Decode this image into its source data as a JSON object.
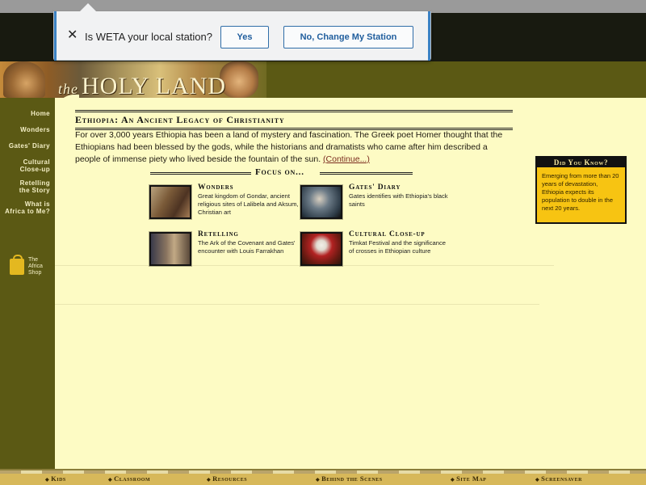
{
  "popup": {
    "question": "Is WETA your local station?",
    "yes_label": "Yes",
    "no_label": "No, Change My Station",
    "close_icon": "close-icon"
  },
  "banner": {
    "title_small": "the",
    "title_large": "HOLY LAND"
  },
  "left_nav": {
    "items": [
      {
        "lines": [
          "Home"
        ]
      },
      {
        "lines": [
          "Wonders"
        ]
      },
      {
        "lines": [
          "Gates' Diary"
        ]
      },
      {
        "lines": [
          "Cultural",
          "Close-up"
        ]
      },
      {
        "lines": [
          "Retelling",
          "the Story"
        ]
      },
      {
        "lines": [
          "What is",
          "Africa to Me?"
        ]
      }
    ],
    "shop": {
      "line1": "The",
      "line2": "Africa",
      "line3": "Shop",
      "icon": "shopping-bag-icon"
    }
  },
  "main": {
    "title": "Ethiopia: An Ancient Legacy of Christianity",
    "intro": "For over 3,000 years Ethiopia has been a land of mystery and fascination. The Greek poet Homer thought that the Ethiopians had been blessed by the gods, while the historians and dramatists who came after him described a people of immense piety who lived beside the fountain of the sun.",
    "continue_link": "(Continue...)",
    "focus_heading": "Focus on...",
    "focus_items": [
      {
        "title": "Wonders",
        "desc": "Great kingdom of Gondar, ancient religious sites of Lalibela and Aksum, Christian art"
      },
      {
        "title": "Gates' Diary",
        "desc": "Gates identifies with Ethiopia's black saints"
      },
      {
        "title": "Retelling",
        "desc": "The Ark of the Covenant and Gates' encounter with Louis Farrakhan"
      },
      {
        "title": "Cultural Close-up",
        "desc": "Timkat Festival and the significance of crosses in Ethiopian culture"
      }
    ]
  },
  "did_you_know": {
    "header": "Did You Know?",
    "text": "Emerging from more than 20 years of devastation, Ethiopia expects its population to double in the next 20 years."
  },
  "bottom_nav": {
    "items": [
      "Kids",
      "Classroom",
      "Resources",
      "Behind the Scenes",
      "Site Map",
      "Screensaver"
    ]
  },
  "colors": {
    "olive": "#5b5914",
    "cream": "#fdfbc4",
    "gold": "#f7c412",
    "link_blue": "#1f5d9d"
  }
}
